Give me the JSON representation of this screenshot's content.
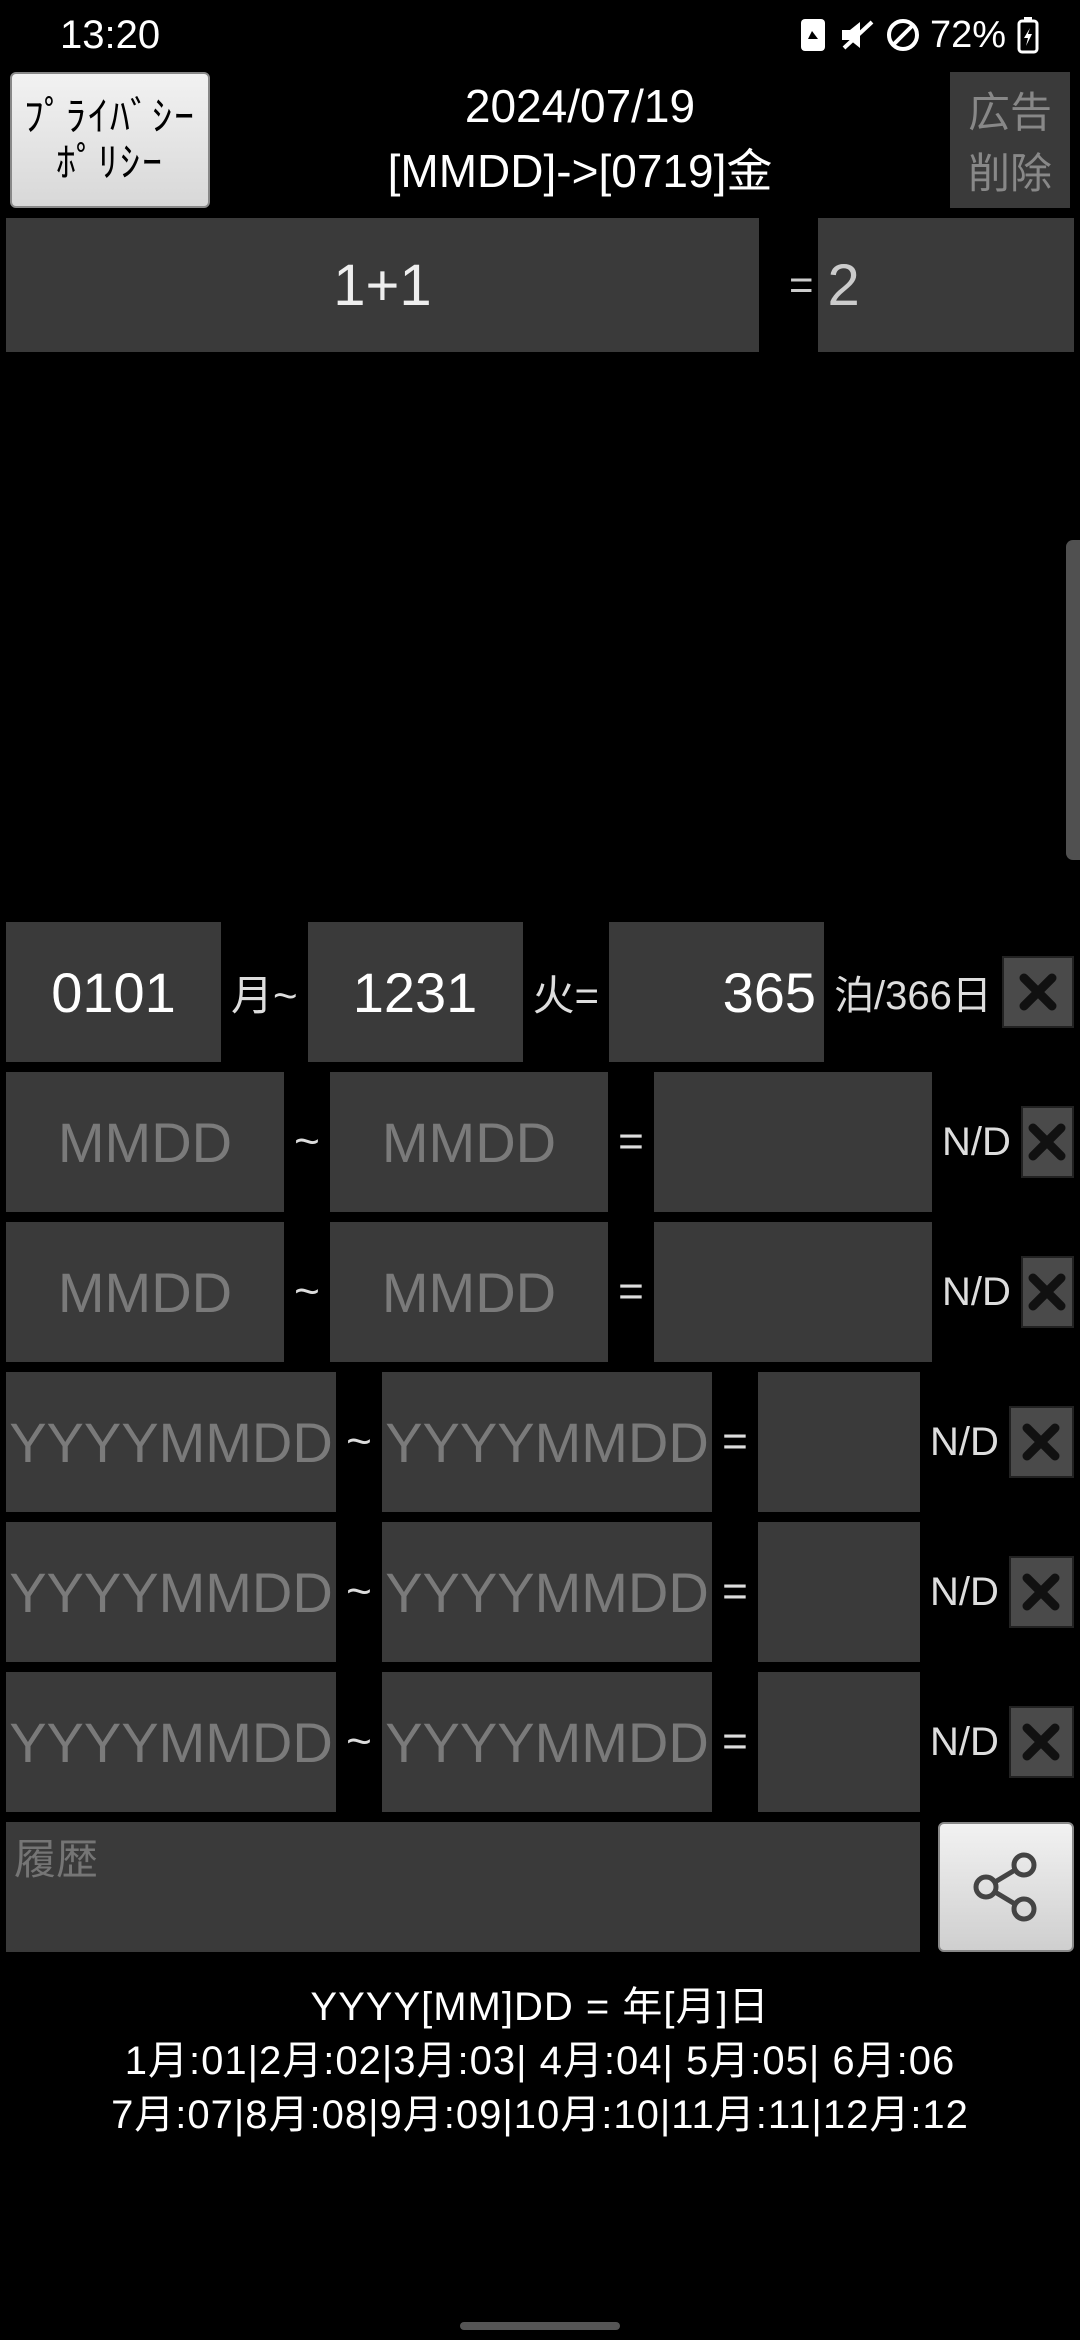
{
  "status": {
    "time": "13:20",
    "battery": "72%"
  },
  "header": {
    "privacy_l1": "ﾌﾟﾗｲﾊﾞｼｰ",
    "privacy_l2": "ﾎﾟﾘｼｰ",
    "date_line": "2024/07/19",
    "format_line": "[MMDD]->[0719]金",
    "ad_l1": "広告",
    "ad_l2": "削除"
  },
  "calc": {
    "expr": "1+1",
    "eq": "=",
    "result": "2"
  },
  "row1": {
    "start": "0101",
    "start_label": "月~",
    "end": "1231",
    "end_label": "火=",
    "days": "365",
    "days_suffix": "泊/366日"
  },
  "mmdd_ph": "MMDD",
  "yyyy_ph": "YYYYMMDD",
  "sep": "~",
  "eq": "=",
  "nd": "N/D",
  "history_ph": "履歴",
  "footer": {
    "l1": "YYYY[MM]DD = 年[月]日",
    "l2": "1月:01|2月:02|3月:03| 4月:04| 5月:05| 6月:06",
    "l3": "7月:07|8月:08|9月:09|10月:10|11月:11|12月:12"
  }
}
